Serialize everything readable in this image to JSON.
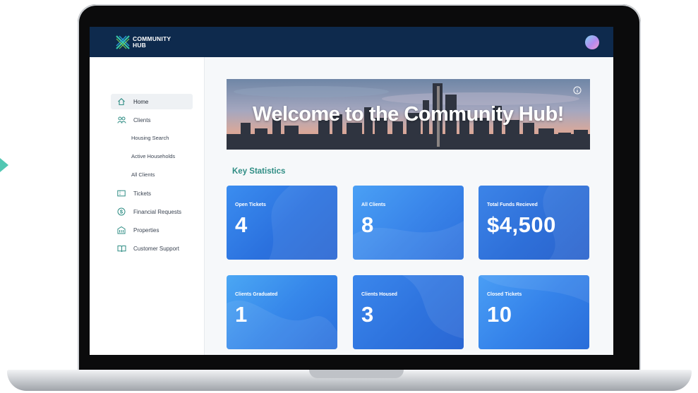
{
  "brand": {
    "line1": "COMMUNITY",
    "line2": "HUB",
    "icon": "hub-logo-icon"
  },
  "header": {
    "avatar_icon": "user-avatar"
  },
  "sidebar": {
    "items": [
      {
        "label": "Home",
        "icon": "home-icon",
        "active": true
      },
      {
        "label": "Clients",
        "icon": "users-icon",
        "expanded": true
      },
      {
        "label": "Tickets",
        "icon": "ticket-icon"
      },
      {
        "label": "Financial Requests",
        "icon": "dollar-circle-icon"
      },
      {
        "label": "Properties",
        "icon": "building-icon"
      },
      {
        "label": "Customer Support",
        "icon": "book-open-icon"
      }
    ],
    "clients_sub": [
      {
        "label": "Housing Search"
      },
      {
        "label": "Active Households"
      },
      {
        "label": "All Clients"
      }
    ]
  },
  "main": {
    "banner_title": "Welcome to the Community Hub!",
    "section_title": "Key Statistics",
    "stats": [
      {
        "label": "Open Tickets",
        "value": "4"
      },
      {
        "label": "All Clients",
        "value": "8"
      },
      {
        "label": "Total Funds Recieved",
        "value": "$4,500"
      },
      {
        "label": "Clients Graduated",
        "value": "1"
      },
      {
        "label": "Clients Housed",
        "value": "3"
      },
      {
        "label": "Closed Tickets",
        "value": "10"
      }
    ]
  },
  "colors": {
    "header_bg": "#0e2a4d",
    "accent_teal": "#2f8d84",
    "card_blue": "#2f7fe6"
  }
}
